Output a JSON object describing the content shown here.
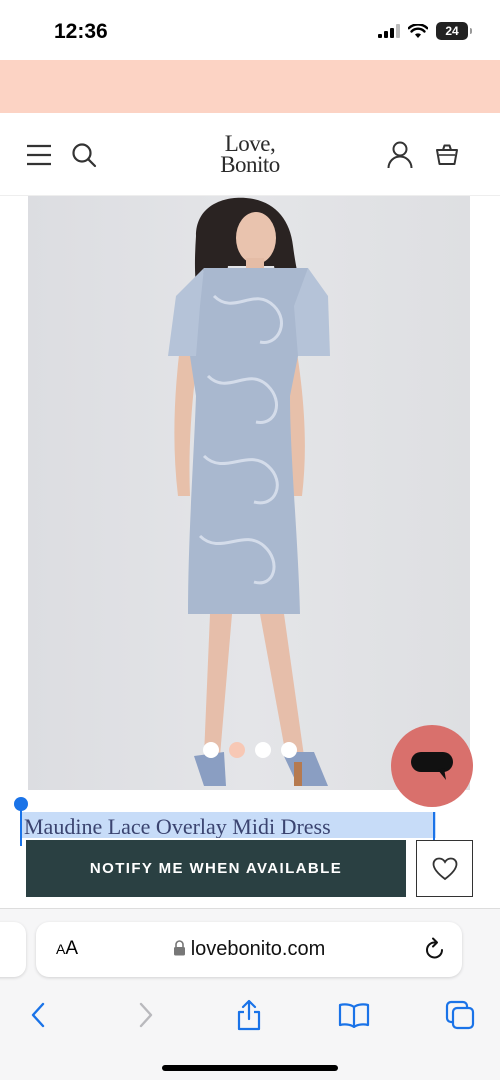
{
  "status_bar": {
    "time": "12:36",
    "battery": "24"
  },
  "header": {
    "logo_line1": "Love,",
    "logo_line2": "Bonito"
  },
  "product": {
    "title": "Maudine Lace Overlay Midi Dress",
    "image_count": 4,
    "active_image_index": 1,
    "notify_label": "NOTIFY ME WHEN AVAILABLE"
  },
  "browser": {
    "aa_label": "AA",
    "url": "lovebonito.com"
  },
  "colors": {
    "promo_banner": "#fcd3c4",
    "notify_button": "#2a4042",
    "chat_button": "#d9706c",
    "selection_highlight": "#c7dcf8",
    "ios_blue": "#1a73e8"
  },
  "icons": [
    "menu-icon",
    "search-icon",
    "account-icon",
    "bag-icon",
    "chat-icon",
    "heart-icon",
    "lock-icon",
    "reload-icon",
    "back-icon",
    "forward-icon",
    "share-icon",
    "bookmarks-icon",
    "tabs-icon"
  ]
}
